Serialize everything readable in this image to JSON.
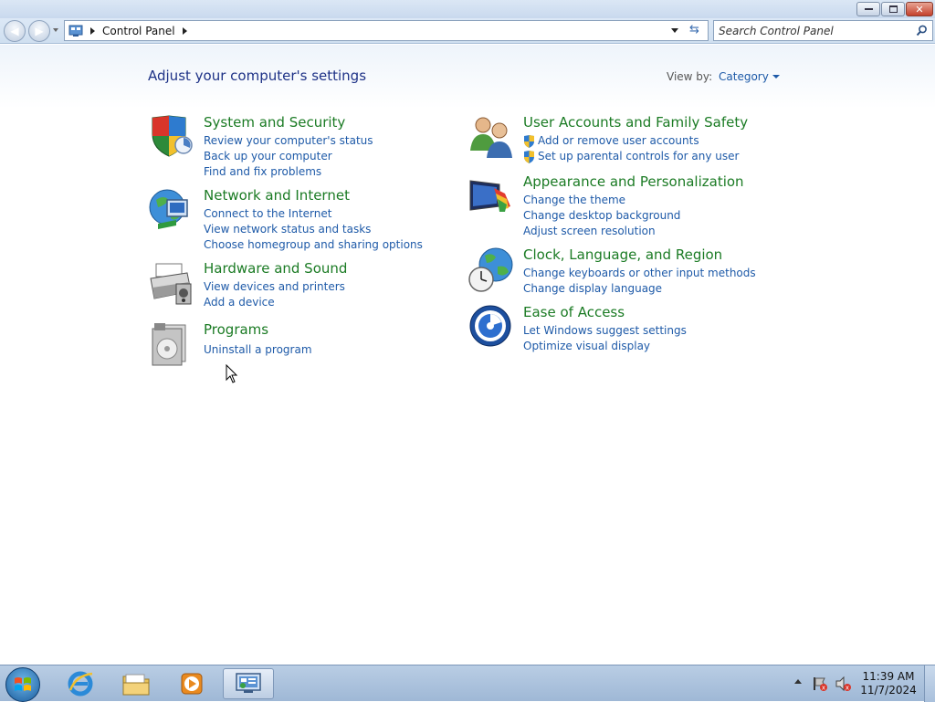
{
  "window": {
    "breadcrumb": "Control Panel",
    "search_placeholder": "Search Control Panel"
  },
  "page": {
    "title": "Adjust your computer's settings",
    "view_by_label": "View by:",
    "view_by_value": "Category"
  },
  "categories": [
    {
      "title": "System and Security",
      "links": [
        "Review your computer's status",
        "Back up your computer",
        "Find and fix problems"
      ]
    },
    {
      "title": "Network and Internet",
      "links": [
        "Connect to the Internet",
        "View network status and tasks",
        "Choose homegroup and sharing options"
      ]
    },
    {
      "title": "Hardware and Sound",
      "links": [
        "View devices and printers",
        "Add a device"
      ]
    },
    {
      "title": "Programs",
      "links": [
        "Uninstall a program"
      ]
    },
    {
      "title": "User Accounts and Family Safety",
      "links": [
        "Add or remove user accounts",
        "Set up parental controls for any user"
      ]
    },
    {
      "title": "Appearance and Personalization",
      "links": [
        "Change the theme",
        "Change desktop background",
        "Adjust screen resolution"
      ]
    },
    {
      "title": "Clock, Language, and Region",
      "links": [
        "Change keyboards or other input methods",
        "Change display language"
      ]
    },
    {
      "title": "Ease of Access",
      "links": [
        "Let Windows suggest settings",
        "Optimize visual display"
      ]
    }
  ],
  "taskbar": {
    "time": "11:39 AM",
    "date": "11/7/2024",
    "icons": [
      "windows-start-icon",
      "internet-explorer-icon",
      "file-explorer-icon",
      "media-player-icon",
      "control-panel-icon"
    ]
  },
  "colors": {
    "category_title": "#1b7b24",
    "link": "#1e5aa8",
    "page_title": "#1e3287"
  }
}
